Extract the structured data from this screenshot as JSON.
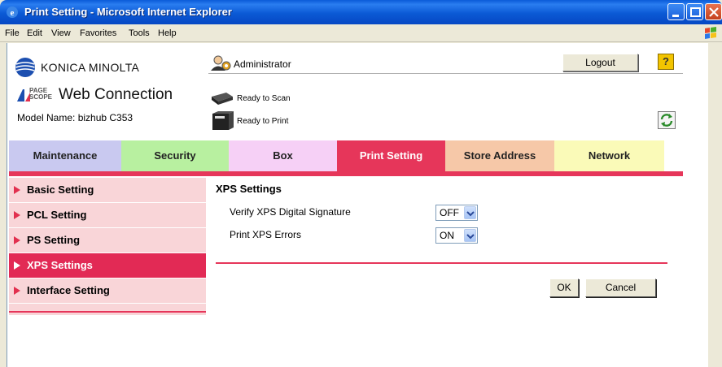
{
  "window": {
    "title": "Print Setting - Microsoft Internet Explorer"
  },
  "menu": [
    "File",
    "Edit",
    "View",
    "Favorites",
    "Tools",
    "Help"
  ],
  "header": {
    "brand": "KONICA MINOLTA",
    "pagescope_line1": "PAGE",
    "pagescope_line2": "SCOPE",
    "product": "Web Connection",
    "model": "Model Name: bizhub C353",
    "user": "Administrator",
    "logout_label": "Logout",
    "help_label": "?",
    "scan_status": "Ready to Scan",
    "print_status": "Ready to Print"
  },
  "tabs": [
    {
      "label": "Maintenance",
      "color": "#c9c9f0"
    },
    {
      "label": "Security",
      "color": "#b8f0a0"
    },
    {
      "label": "Box",
      "color": "#f6d0f6"
    },
    {
      "label": "Print Setting",
      "color": "#e6365a",
      "active": true
    },
    {
      "label": "Store Address",
      "color": "#f6c8a8"
    },
    {
      "label": "Network",
      "color": "#fafab8"
    }
  ],
  "sidebar": [
    {
      "label": "Basic Setting"
    },
    {
      "label": "PCL Setting"
    },
    {
      "label": "PS Setting"
    },
    {
      "label": "XPS Settings",
      "active": true
    },
    {
      "label": "Interface Setting"
    }
  ],
  "main": {
    "title": "XPS Settings",
    "rows": [
      {
        "label": "Verify XPS Digital Signature",
        "value": "OFF"
      },
      {
        "label": "Print XPS Errors",
        "value": "ON"
      }
    ],
    "ok_label": "OK",
    "cancel_label": "Cancel"
  },
  "colors": {
    "accent": "#e6365a",
    "sidebar_bg": "#f9d5d8"
  }
}
